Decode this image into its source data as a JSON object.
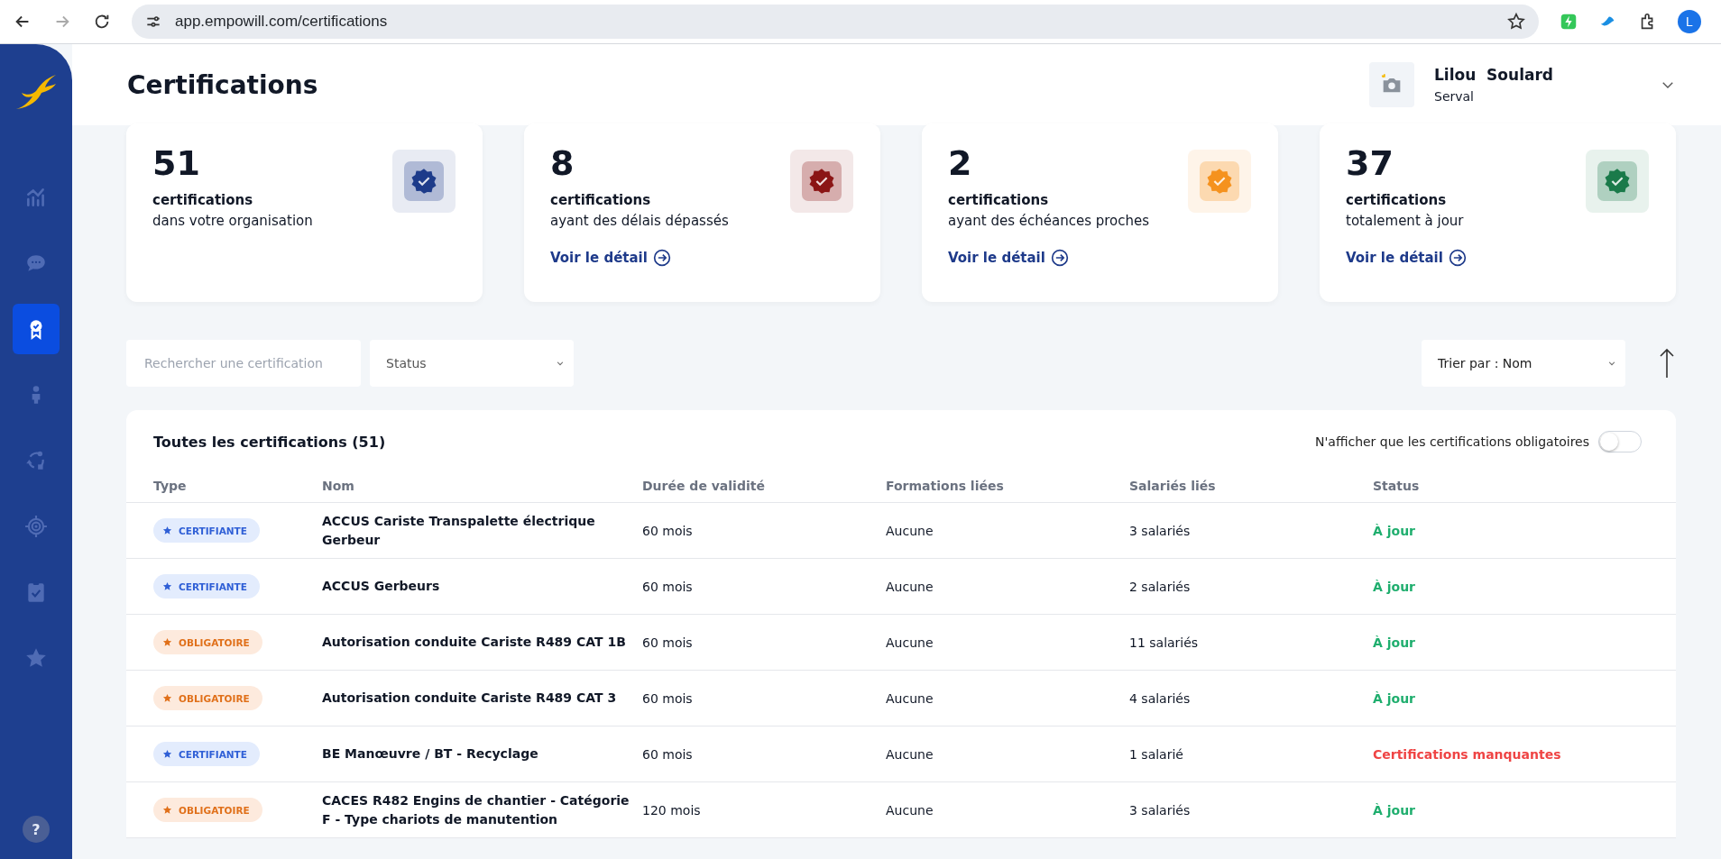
{
  "browser": {
    "url": "app.empowill.com/certifications",
    "profile_initial": "L"
  },
  "sidebar": {
    "items": [
      {
        "selected": false
      },
      {
        "selected": false
      },
      {
        "selected": true
      },
      {
        "selected": false
      },
      {
        "selected": false
      },
      {
        "selected": false
      },
      {
        "selected": false
      },
      {
        "selected": false
      }
    ],
    "help": "?"
  },
  "header": {
    "title": "Certifications",
    "user": {
      "name": "Lilou  Soulard",
      "company": "Serval"
    }
  },
  "stats": [
    {
      "value": "51",
      "label": "certifications",
      "description": "dans votre organisation",
      "color": "#1d3b8a"
    },
    {
      "value": "8",
      "label": "certifications",
      "description": "ayant des délais dépassés",
      "link": "Voir le détail",
      "color": "#8b1515"
    },
    {
      "value": "2",
      "label": "certifications",
      "description": "ayant des échéances proches",
      "link": "Voir le détail",
      "color": "#f5921e"
    },
    {
      "value": "37",
      "label": "certifications",
      "description": "totalement à jour",
      "link": "Voir le détail",
      "color": "#1a7a4a"
    }
  ],
  "filters": {
    "search": {
      "placeholder": "Rechercher une certification"
    },
    "status": {
      "value": "Status"
    },
    "sort": {
      "value": "Trier par : Nom"
    }
  },
  "table": {
    "title": "Toutes les certifications (51)",
    "toggle": {
      "label": "N'afficher que les certifications obligatoires",
      "on": false
    },
    "columns": [
      "Type",
      "Nom",
      "Durée de validité",
      "Formations liées",
      "Salariés liés",
      "Status"
    ],
    "rows": [
      {
        "type": {
          "label": "CERTIFIANTE",
          "kind": "certifiante"
        },
        "name": "ACCUS Cariste Transpalette électrique Gerbeur",
        "duration": "60 mois",
        "trainings": "Aucune",
        "employees": "3 salariés",
        "status": {
          "label": "À jour",
          "kind": "ok"
        }
      },
      {
        "type": {
          "label": "CERTIFIANTE",
          "kind": "certifiante"
        },
        "name": "ACCUS Gerbeurs",
        "duration": "60 mois",
        "trainings": "Aucune",
        "employees": "2 salariés",
        "status": {
          "label": "À jour",
          "kind": "ok"
        }
      },
      {
        "type": {
          "label": "OBLIGATOIRE",
          "kind": "obligatoire"
        },
        "name": "Autorisation conduite Cariste R489 CAT 1B",
        "duration": "60 mois",
        "trainings": "Aucune",
        "employees": "11 salariés",
        "status": {
          "label": "À jour",
          "kind": "ok"
        }
      },
      {
        "type": {
          "label": "OBLIGATOIRE",
          "kind": "obligatoire"
        },
        "name": "Autorisation conduite Cariste R489 CAT 3",
        "duration": "60 mois",
        "trainings": "Aucune",
        "employees": "4 salariés",
        "status": {
          "label": "À jour",
          "kind": "ok"
        }
      },
      {
        "type": {
          "label": "CERTIFIANTE",
          "kind": "certifiante"
        },
        "name": "BE Manœuvre / BT - Recyclage",
        "duration": "60 mois",
        "trainings": "Aucune",
        "employees": "1 salarié",
        "status": {
          "label": "Certifications manquantes",
          "kind": "missing"
        }
      },
      {
        "type": {
          "label": "OBLIGATOIRE",
          "kind": "obligatoire"
        },
        "name": "CACES R482 Engins de chantier - Catégorie F - Type chariots de manutention",
        "duration": "120 mois",
        "trainings": "Aucune",
        "employees": "3 salariés",
        "status": {
          "label": "À jour",
          "kind": "ok"
        }
      }
    ]
  }
}
